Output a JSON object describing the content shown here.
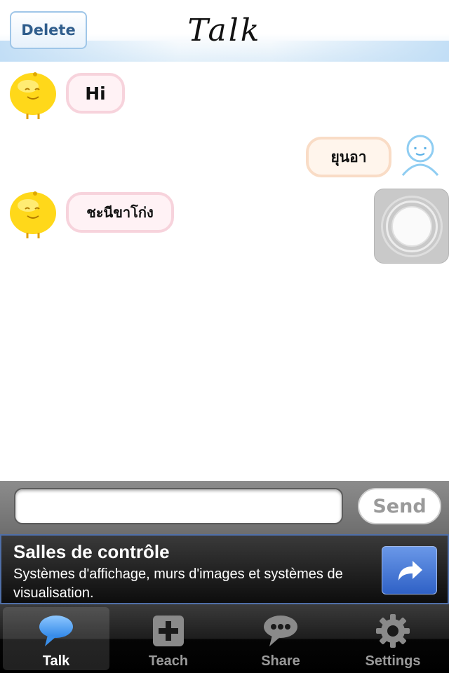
{
  "header": {
    "delete_label": "Delete",
    "title": "Talk"
  },
  "messages": [
    {
      "sender": "bot",
      "text": "Hi"
    },
    {
      "sender": "user",
      "text": "ยุนอา"
    },
    {
      "sender": "bot",
      "text": "ชะนีขาโก่ง"
    }
  ],
  "input": {
    "value": "",
    "placeholder": "",
    "send_label": "Send"
  },
  "ad": {
    "title": "Salles de contrôle",
    "description": "Systèmes d'affichage, murs d'images et systèmes de visualisation."
  },
  "tabs": [
    {
      "label": "Talk",
      "icon": "speech-bubble-icon",
      "active": true
    },
    {
      "label": "Teach",
      "icon": "plus-icon",
      "active": false
    },
    {
      "label": "Share",
      "icon": "ellipsis-bubble-icon",
      "active": false
    },
    {
      "label": "Settings",
      "icon": "gear-icon",
      "active": false
    }
  ],
  "colors": {
    "accent_blue": "#4a8fe0",
    "bot_bubble_border": "#f7d3dc",
    "user_bubble_border": "#f9dcc6",
    "ad_button": "#3f6fd0"
  }
}
